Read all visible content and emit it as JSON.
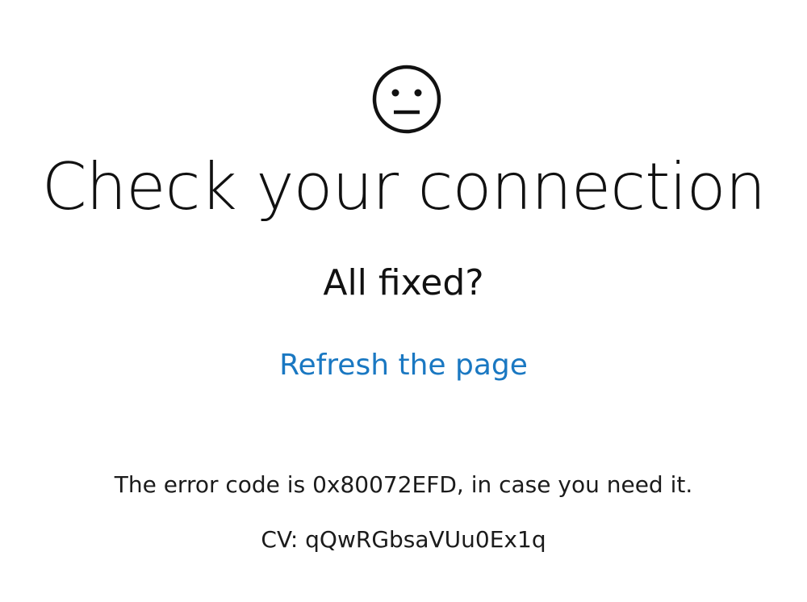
{
  "icon": {
    "name": "sad-face-icon"
  },
  "heading": {
    "title": "Check your connection"
  },
  "prompt": {
    "text": "All fixed?"
  },
  "actions": {
    "refresh_label": "Refresh the page",
    "link_color": "#1a78c2"
  },
  "error": {
    "message": "The error code is 0x80072EFD, in case you need it.",
    "cv": "CV: qQwRGbsaVUu0Ex1q"
  }
}
